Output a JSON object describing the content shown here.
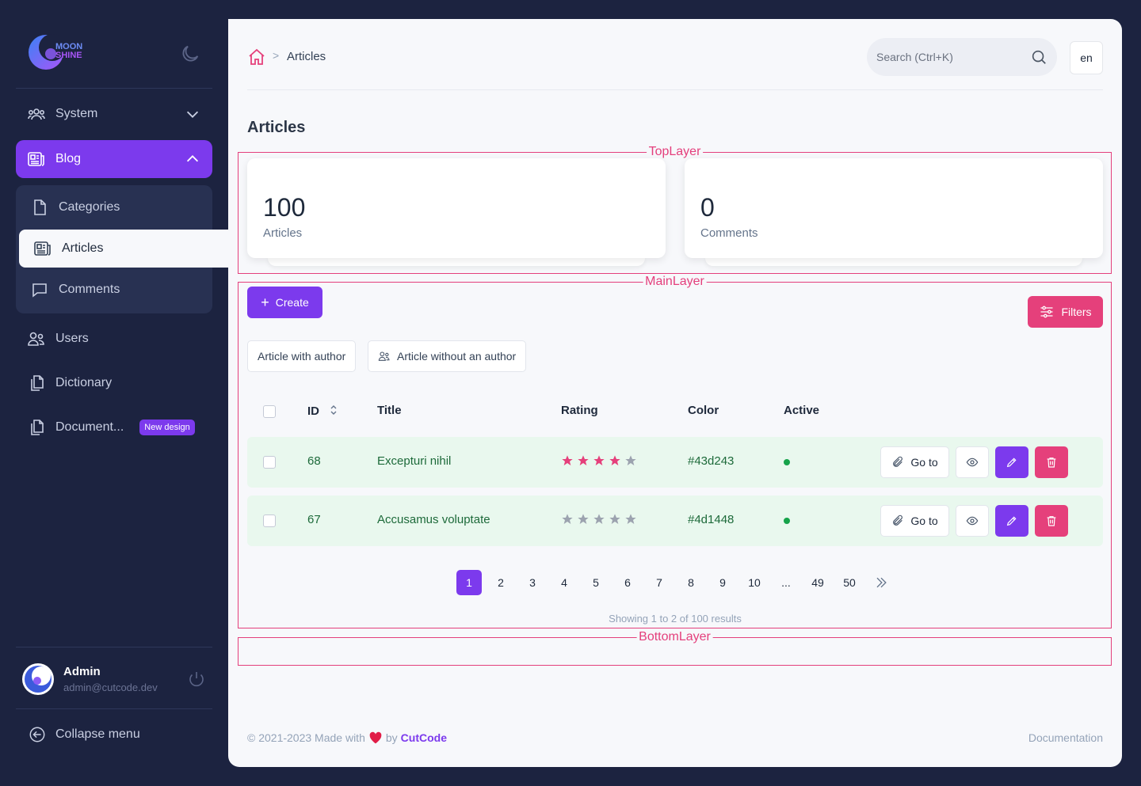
{
  "brand": {
    "logo_line1": "MOON",
    "logo_line2": "SHINE"
  },
  "sidebar": {
    "items": [
      {
        "label": "System"
      },
      {
        "label": "Blog"
      },
      {
        "label": "Users"
      },
      {
        "label": "Dictionary"
      },
      {
        "label": "Document...",
        "badge": "New design"
      }
    ],
    "blog_children": [
      {
        "label": "Categories"
      },
      {
        "label": "Articles"
      },
      {
        "label": "Comments"
      }
    ],
    "user": {
      "name": "Admin",
      "email": "admin@cutcode.dev"
    },
    "collapse_label": "Collapse menu"
  },
  "header": {
    "breadcrumb_current": "Articles",
    "breadcrumb_separator": ">",
    "search_placeholder": "Search (Ctrl+K)",
    "lang": "en"
  },
  "page": {
    "title": "Articles"
  },
  "layers": {
    "top": "TopLayer",
    "main": "MainLayer",
    "bottom": "BottomLayer"
  },
  "metrics": [
    {
      "value": "100",
      "label": "Articles"
    },
    {
      "value": "0",
      "label": "Comments"
    }
  ],
  "actions": {
    "create": "Create",
    "create_icon": "+",
    "filters": "Filters"
  },
  "quick_filters": [
    "Article with author",
    "Article without an author"
  ],
  "table": {
    "headers": {
      "id": "ID",
      "title": "Title",
      "rating": "Rating",
      "color": "Color",
      "active": "Active"
    },
    "rows": [
      {
        "id": "68",
        "title": "Excepturi nihil",
        "rating": 4,
        "color": "#43d243",
        "active": true
      },
      {
        "id": "67",
        "title": "Accusamus voluptate",
        "rating": 0,
        "color": "#4d1448",
        "active": true
      }
    ],
    "go_to_label": "Go to"
  },
  "pagination": {
    "pages": [
      "1",
      "2",
      "3",
      "4",
      "5",
      "6",
      "7",
      "8",
      "9",
      "10",
      "...",
      "49",
      "50"
    ],
    "current": "1",
    "showing": "Showing 1 to 2 of 100 results"
  },
  "footer": {
    "copyright": "© 2021-2023 Made with",
    "by": "by",
    "brand": "CutCode",
    "documentation": "Documentation"
  },
  "colors": {
    "sidebar_bg": "#1c2340",
    "accent_purple": "#7c3aed",
    "accent_pink": "#e5407b",
    "row_bg": "#e9f8ee",
    "star_filled": "#e5407b",
    "star_empty": "#9ca3af"
  }
}
